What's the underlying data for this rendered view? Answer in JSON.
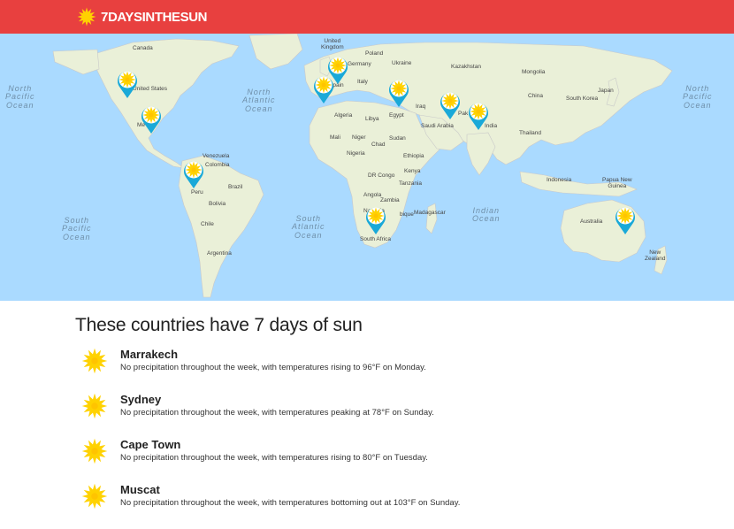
{
  "header": {
    "brand": "7DAYSINTHESUN",
    "brand_icon": "sun-icon",
    "background_color": "#e8403f"
  },
  "map": {
    "oceans": {
      "north_pacific_west": "North\nPacific\nOcean",
      "north_pacific_east": "North\nPacific\nOcean",
      "north_atlantic": "North\nAtlantic\nOcean",
      "south_pacific": "South\nPacific\nOcean",
      "south_atlantic": "South\nAtlantic\nOcean",
      "indian": "Indian\nOcean"
    },
    "labels": {
      "canada": "Canada",
      "united_states": "United States",
      "mexico": "Me",
      "venezuela": "Venezuela",
      "colombia": "Colombia",
      "peru": "Peru",
      "brazil": "Brazil",
      "bolivia": "Bolivia",
      "chile": "Chile",
      "argentina": "Argentina",
      "united_kingdom": "United\nKingdom",
      "poland": "Poland",
      "germany": "Germany",
      "ukraine": "Ukraine",
      "italy": "Italy",
      "spain": "Spain",
      "kazakhstan": "Kazakhstan",
      "mongolia": "Mongolia",
      "china": "China",
      "japan": "Japan",
      "south_korea": "South Korea",
      "iraq": "Iraq",
      "saudi_arabia": "Saudi Arabia",
      "pakistan": "Pak",
      "india": "India",
      "thailand": "Thailand",
      "algeria": "Algeria",
      "libya": "Libya",
      "egypt": "Egypt",
      "mali": "Mali",
      "niger": "Niger",
      "chad": "Chad",
      "sudan": "Sudan",
      "nigeria": "Nigeria",
      "ethiopia": "Ethiopia",
      "kenya": "Kenya",
      "drc": "DR Congo",
      "tanzania": "Tanzania",
      "angola": "Angola",
      "zambia": "Zambia",
      "namibia": "Namibia",
      "mozambique": "bique",
      "madagascar": "Madagascar",
      "south_africa": "South Africa",
      "indonesia": "Indonesia",
      "papua_new_guinea": "Papua New\nGuinea",
      "australia": "Australia",
      "new_zealand": "New\nZealand"
    },
    "pin_icon": "sun-map-pin-icon",
    "pin_color": "#1aa9d8"
  },
  "content": {
    "heading": "These countries have 7 days of sun",
    "cities": [
      {
        "name": "Marrakech",
        "description": "No precipitation throughout the week, with temperatures rising to 96°F on Monday."
      },
      {
        "name": "Sydney",
        "description": "No precipitation throughout the week, with temperatures peaking at 78°F on Sunday."
      },
      {
        "name": "Cape Town",
        "description": "No precipitation throughout the week, with temperatures rising to 80°F on Tuesday."
      },
      {
        "name": "Muscat",
        "description": "No precipitation throughout the week, with temperatures bottoming out at 103°F on Sunday."
      }
    ],
    "city_icon": "sun-icon"
  },
  "colors": {
    "sun_yellow": "#ffd200",
    "ocean": "#aadaff",
    "land": "#eaf0d8"
  }
}
